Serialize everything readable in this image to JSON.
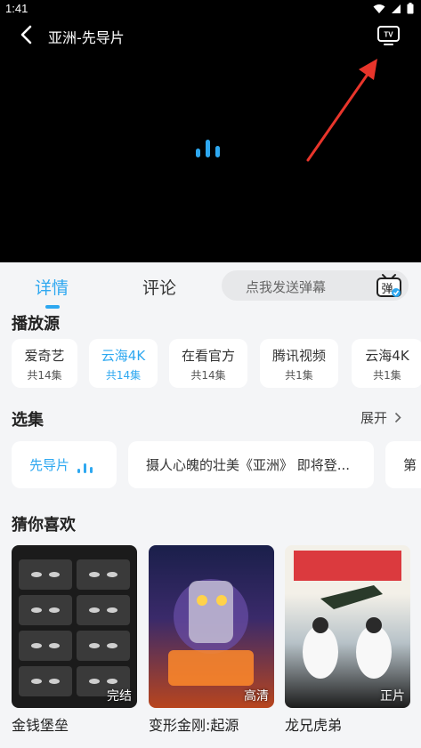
{
  "status_bar": {
    "time": "1:41"
  },
  "player": {
    "title": "亚洲-先导片",
    "accent_color": "#2ea8f0",
    "annotation_color": "#e8352b"
  },
  "tabs": [
    {
      "label": "详情",
      "active": true
    },
    {
      "label": "评论",
      "active": false
    }
  ],
  "danmaku": {
    "placeholder": "点我发送弹幕",
    "icon_text": "弹"
  },
  "sources_section": {
    "title": "播放源",
    "items": [
      {
        "name": "爱奇艺",
        "count": "共14集",
        "active": false
      },
      {
        "name": "云海4K",
        "count": "共14集",
        "active": true
      },
      {
        "name": "在看官方",
        "count": "共14集",
        "active": false
      },
      {
        "name": "腾讯视频",
        "count": "共1集",
        "active": false
      },
      {
        "name": "云海4K",
        "count": "共1集",
        "active": false
      }
    ]
  },
  "episodes_section": {
    "title": "选集",
    "expand_label": "展开",
    "items": [
      {
        "label": "先导片",
        "active": true
      },
      {
        "label": "摄人心魄的壮美《亚洲》 即将登...",
        "active": false
      },
      {
        "label": "第",
        "active": false
      }
    ]
  },
  "recommend_section": {
    "title": "猜你喜欢",
    "items": [
      {
        "title": "金钱堡垒",
        "badge": "完结"
      },
      {
        "title": "变形金刚:起源",
        "badge": "高清"
      },
      {
        "title": "龙兄虎弟",
        "badge": "正片"
      }
    ]
  }
}
